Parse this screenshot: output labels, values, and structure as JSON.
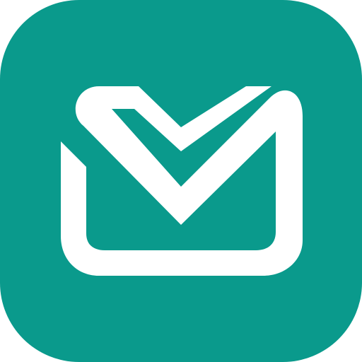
{
  "icon": {
    "name": "mail-app-icon",
    "glyph": "envelope-checkmark-icon",
    "colors": {
      "background": "#0a9a8c",
      "glyph": "#ffffff",
      "canvas": "#ffffff"
    }
  }
}
